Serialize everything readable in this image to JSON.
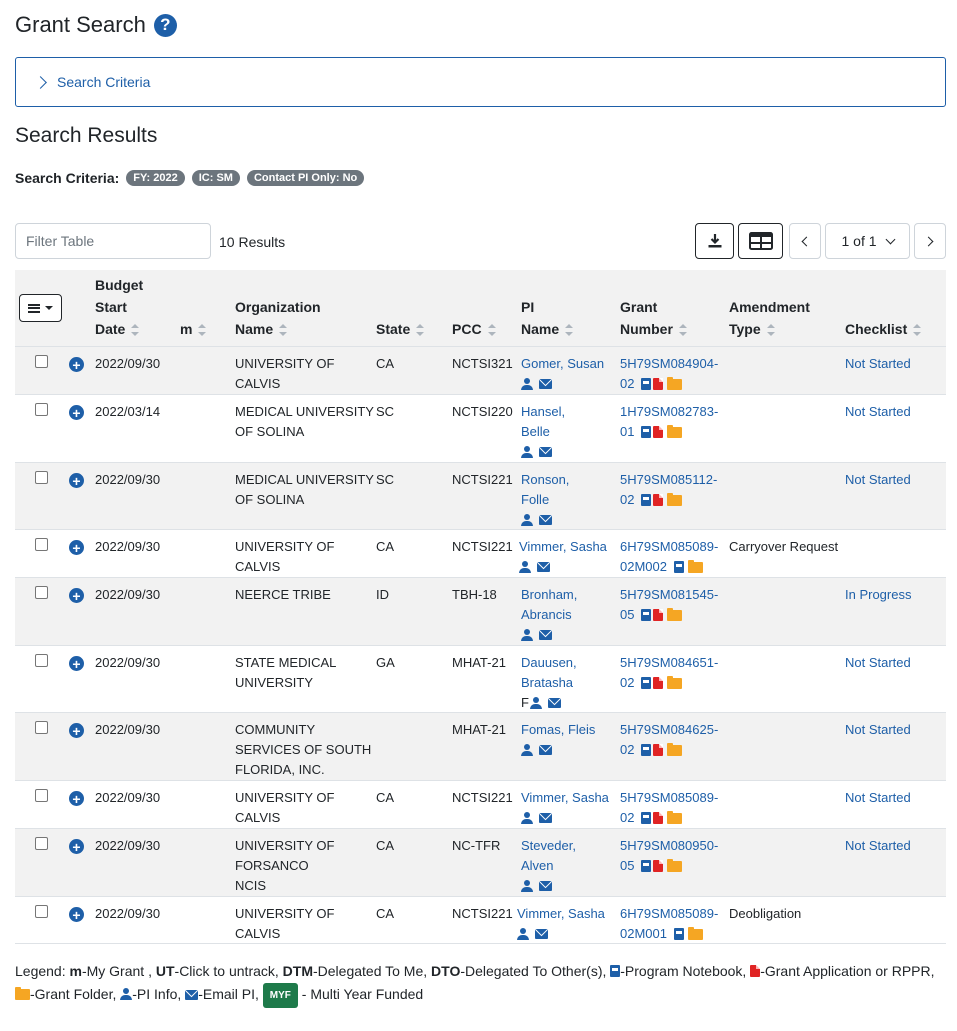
{
  "page": {
    "title": "Grant Search",
    "help_icon": "question-circle-icon"
  },
  "criteria_panel": {
    "label": "Search Criteria"
  },
  "results": {
    "title": "Search Results",
    "criteria_label": "Search Criteria:",
    "badges": [
      "FY: 2022",
      "IC: SM",
      "Contact PI Only: No"
    ],
    "filter_placeholder": "Filter Table",
    "count": "10 Results",
    "pagination": "1 of 1"
  },
  "table": {
    "headers": {
      "budget_start_date": [
        "Budget",
        "Start",
        "Date"
      ],
      "m": "m",
      "organization_name": [
        "Organization",
        "Name"
      ],
      "state": "State",
      "pcc": "PCC",
      "pi_name": [
        "PI",
        "Name"
      ],
      "grant_number": [
        "Grant",
        "Number"
      ],
      "amendment_type": [
        "Amendment",
        "Type"
      ],
      "checklist": "Checklist"
    },
    "rows": [
      {
        "date": "2022/09/30",
        "org": [
          "UNIVERSITY OF",
          "CALVIS"
        ],
        "state": "CA",
        "pcc": "NCTSI321",
        "pi": [
          "Gomer, Susan"
        ],
        "pi_suffix": "",
        "grant": [
          "5H79SM084904-",
          "02"
        ],
        "icons": [
          "book",
          "pdf",
          "folder"
        ],
        "amend": "",
        "check": "Not Started"
      },
      {
        "date": "2022/03/14",
        "org": [
          "MEDICAL UNIVERSITY",
          "OF SOLINA"
        ],
        "state": "SC",
        "pcc": "NCTSI220",
        "pi": [
          "Hansel,",
          "Belle"
        ],
        "pi_suffix": "",
        "grant": [
          "1H79SM082783-",
          "01"
        ],
        "icons": [
          "book",
          "pdf",
          "folder"
        ],
        "amend": "",
        "check": "Not Started"
      },
      {
        "date": "2022/09/30",
        "org": [
          "MEDICAL UNIVERSITY",
          "OF SOLINA"
        ],
        "state": "SC",
        "pcc": "NCTSI221",
        "pi": [
          "Ronson,",
          "Folle"
        ],
        "pi_suffix": "",
        "grant": [
          "5H79SM085112-",
          "02"
        ],
        "icons": [
          "book",
          "pdf",
          "folder"
        ],
        "amend": "",
        "check": "Not Started"
      },
      {
        "date": "2022/09/30",
        "org": [
          "UNIVERSITY OF",
          "CALVIS"
        ],
        "state": "CA",
        "pcc": "NCTSI221",
        "pi": [
          "Vimmer, Sasha"
        ],
        "pi_suffix": "",
        "grant": [
          "6H79SM085089-",
          "02M002"
        ],
        "icons": [
          "book",
          "folder"
        ],
        "amend": "Carryover Request",
        "check": ""
      },
      {
        "date": "2022/09/30",
        "org": [
          "NEERCE TRIBE"
        ],
        "state": "ID",
        "pcc": "TBH-18",
        "pi": [
          "Bronham,",
          "Abrancis"
        ],
        "pi_suffix": "",
        "grant": [
          "5H79SM081545-",
          "05"
        ],
        "icons": [
          "book",
          "pdf",
          "folder"
        ],
        "amend": "",
        "check": "In Progress"
      },
      {
        "date": "2022/09/30",
        "org": [
          "STATE MEDICAL",
          "UNIVERSITY"
        ],
        "state": "GA",
        "pcc": "MHAT-21",
        "pi": [
          "Dauusen,",
          "Bratasha"
        ],
        "pi_suffix": "F",
        "grant": [
          "5H79SM084651-",
          "02"
        ],
        "icons": [
          "book",
          "pdf",
          "folder"
        ],
        "amend": "",
        "check": "Not Started"
      },
      {
        "date": "2022/09/30",
        "org": [
          "COMMUNITY",
          "SERVICES OF SOUTH",
          "FLORIDA, INC."
        ],
        "state": "",
        "pcc": "MHAT-21",
        "pi": [
          "Fomas, Fleis"
        ],
        "pi_suffix": "",
        "grant": [
          "5H79SM084625-",
          "02"
        ],
        "icons": [
          "book",
          "pdf",
          "folder"
        ],
        "amend": "",
        "check": "Not Started"
      },
      {
        "date": "2022/09/30",
        "org": [
          "UNIVERSITY OF",
          "CALVIS"
        ],
        "state": "CA",
        "pcc": "NCTSI221",
        "pi": [
          "Vimmer, Sasha"
        ],
        "pi_suffix": "",
        "grant": [
          "5H79SM085089-",
          "02"
        ],
        "icons": [
          "book",
          "pdf",
          "folder"
        ],
        "amend": "",
        "check": "Not Started"
      },
      {
        "date": "2022/09/30",
        "org": [
          "UNIVERSITY OF",
          "FORSANCO",
          "NCIS"
        ],
        "state": "CA",
        "pcc": "NC-TFR",
        "pi": [
          "Steveder,",
          "Alven"
        ],
        "pi_suffix": "",
        "grant": [
          "5H79SM080950-",
          "05"
        ],
        "icons": [
          "book",
          "pdf",
          "folder"
        ],
        "amend": "",
        "check": "Not Started"
      },
      {
        "date": "2022/09/30",
        "org": [
          "UNIVERSITY OF",
          "CALVIS"
        ],
        "state": "CA",
        "pcc": "NCTSI221",
        "pi": [
          "Vimmer, Sasha"
        ],
        "pi_suffix": "",
        "grant": [
          "6H79SM085089-",
          "02M001"
        ],
        "icons": [
          "book",
          "folder"
        ],
        "amend": "Deobligation",
        "check": ""
      }
    ]
  },
  "legend": {
    "prefix": "Legend: ",
    "m_key": "m",
    "m_text": "-My Grant , ",
    "ut_key": "UT",
    "ut_text": "-Click to untrack, ",
    "dtm_key": "DTM",
    "dtm_text": "-Delegated To Me, ",
    "dto_key": "DTO",
    "dto_text": "-Delegated To Other(s), ",
    "notebook_text": "-Program Notebook, ",
    "app_text": "-Grant Application or RPPR, ",
    "folder_text": "-Grant Folder, ",
    "pi_text": "-PI Info, ",
    "email_text": "-Email PI, ",
    "myf_badge": "MYF",
    "myf_text": " - Multi Year Funded"
  },
  "colors": {
    "primary": "#1e5fa8",
    "pdf": "#e02424",
    "folder": "#f5a623",
    "myf": "#1e7a4a",
    "badge": "#6c757d"
  }
}
